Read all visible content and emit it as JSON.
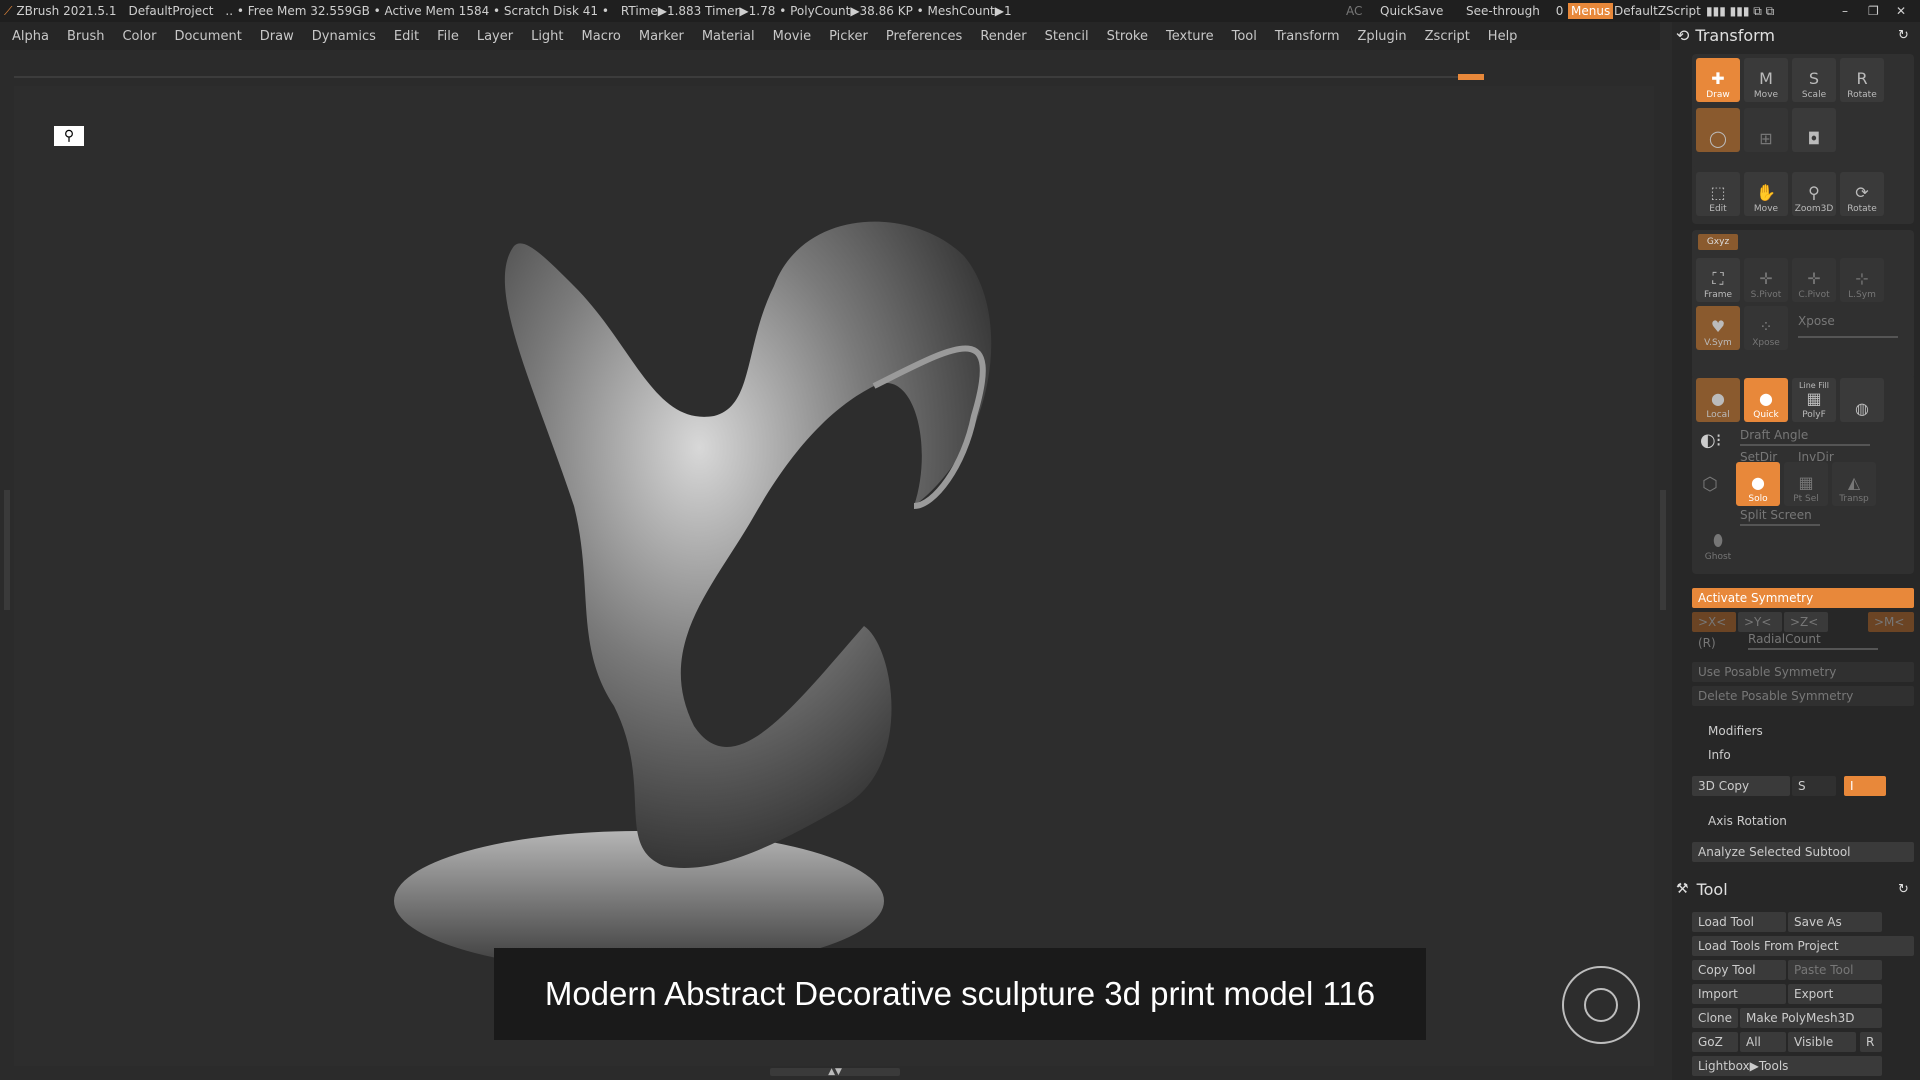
{
  "titlebar": {
    "app": "ZBrush 2021.5.1",
    "project": "DefaultProject",
    "stats": ".. • Free Mem 32.559GB • Active Mem 1584 • Scratch Disk 41 •",
    "rtime": "RTime▶1.883 Timer▶1.78 • PolyCount▶38.86 KP • MeshCount▶1",
    "ac": "AC",
    "quicksave": "QuickSave",
    "seethrough": "See-through",
    "seethrough_value": "0",
    "menus": "Menus",
    "script": "DefaultZScript"
  },
  "menubar": [
    "Alpha",
    "Brush",
    "Color",
    "Document",
    "Draw",
    "Dynamics",
    "Edit",
    "File",
    "Layer",
    "Light",
    "Macro",
    "Marker",
    "Material",
    "Movie",
    "Picker",
    "Preferences",
    "Render",
    "Stencil",
    "Stroke",
    "Texture",
    "Tool",
    "Transform",
    "Zplugin",
    "Zscript",
    "Help"
  ],
  "caption": "Modern Abstract Decorative sculpture 3d print model 116",
  "transform": {
    "title": "Transform",
    "row1": [
      "Draw",
      "Move",
      "Scale",
      "Rotate"
    ],
    "row3": [
      "Edit",
      "Move",
      "Zoom3D",
      "Rotate"
    ],
    "xyz": "Gxyz",
    "frame_row": [
      "Frame",
      "S.Pivot",
      "C.Pivot",
      "L.Sym"
    ],
    "sym_row": [
      "V.Sym",
      "Xpose"
    ],
    "xpose_label": "Xpose",
    "fill_row": [
      "Local",
      "Quick",
      "PolyF"
    ],
    "line_fill": "Line Fill",
    "draft_angle": "Draft Angle",
    "setdir": "SetDir",
    "invdir": "InvDir",
    "solo_row": [
      "Solo",
      "Pt Sel",
      "Transp"
    ],
    "split_screen": "Split Screen",
    "ghost": "Ghost",
    "activate_symmetry": "Activate Symmetry",
    "axes": [
      ">X<",
      ">Y<",
      ">Z<",
      ">M<"
    ],
    "r": "(R)",
    "radial_count": "RadialCount",
    "use_posable": "Use Posable Symmetry",
    "delete_posable": "Delete Posable Symmetry",
    "modifiers": "Modifiers",
    "info": "Info",
    "copy3d": "3D Copy",
    "s": "S",
    "i": "I",
    "axis_rotation": "Axis Rotation",
    "analyze": "Analyze Selected Subtool"
  },
  "tool": {
    "title": "Tool",
    "load_tool": "Load Tool",
    "save_as": "Save As",
    "load_from_project": "Load Tools From Project",
    "copy_tool": "Copy Tool",
    "paste_tool": "Paste Tool",
    "import": "Import",
    "export": "Export",
    "clone": "Clone",
    "make_polymesh": "Make PolyMesh3D",
    "goz": "GoZ",
    "all": "All",
    "visible": "Visible",
    "r": "R",
    "lightbox": "Lightbox▶Tools"
  }
}
